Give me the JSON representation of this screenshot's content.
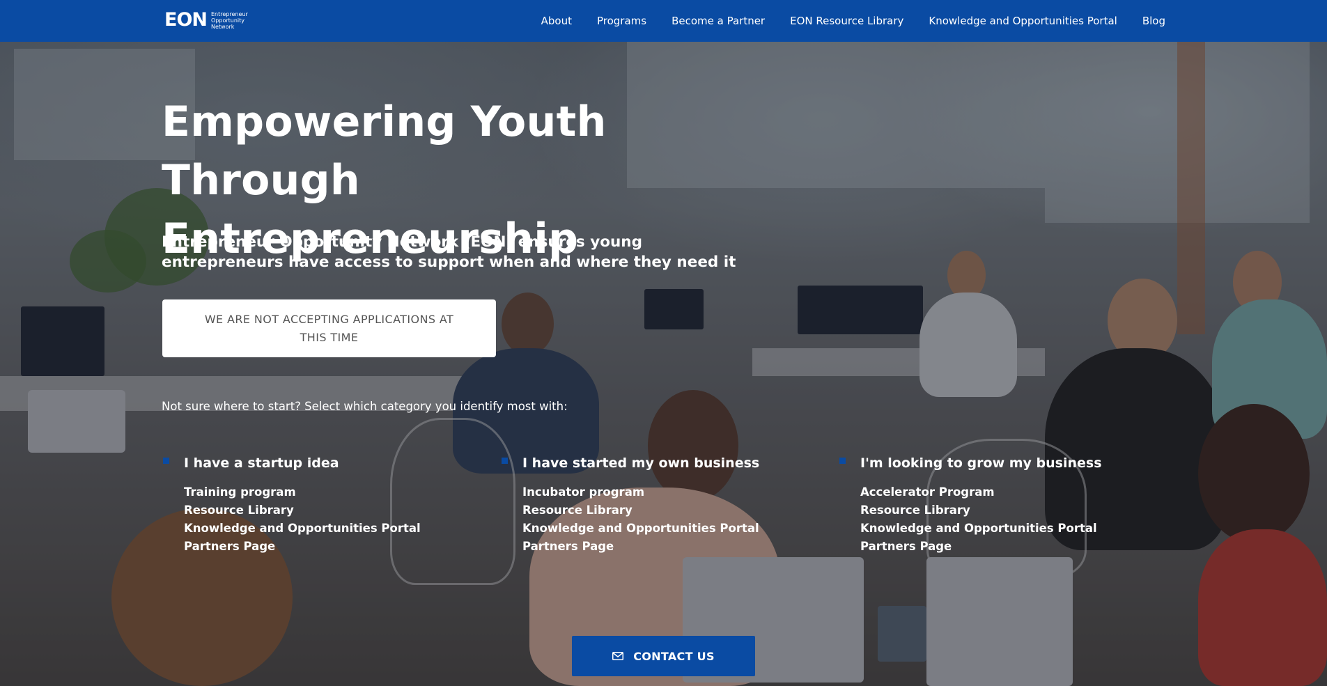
{
  "brand": {
    "logo_mark": "EON",
    "logo_lines": [
      "Entrepreneur",
      "Opportunity",
      "Network"
    ],
    "primary_color": "#0a4ba3"
  },
  "nav": {
    "items": [
      {
        "label": "About"
      },
      {
        "label": "Programs"
      },
      {
        "label": "Become a Partner"
      },
      {
        "label": "EON Resource Library"
      },
      {
        "label": "Knowledge and Opportunities Portal"
      },
      {
        "label": "Blog"
      }
    ]
  },
  "hero": {
    "title_line1": "Empowering Youth",
    "title_line2": "Through Entrepreneurship",
    "subtitle": "Entrepreneur Opportunity Network (EON) ensures young entrepreneurs have access to support when and where they need it",
    "status_button": "WE ARE NOT ACCEPTING APPLICATIONS AT THIS TIME",
    "prompt": "Not sure where to start? Select which category you identify most with:"
  },
  "categories": [
    {
      "title": "I have a startup idea",
      "links": [
        "Training program",
        "Resource Library",
        "Knowledge and Opportunities Portal",
        "Partners Page"
      ]
    },
    {
      "title": "I have started my own business",
      "links": [
        "Incubator program",
        "Resource Library",
        "Knowledge and Opportunities Portal",
        "Partners Page"
      ]
    },
    {
      "title": "I'm looking to grow my business",
      "links": [
        "Accelerator Program",
        "Resource Library",
        "Knowledge and Opportunities Portal",
        "Partners Page"
      ]
    }
  ],
  "contact": {
    "label": "CONTACT US",
    "icon": "envelope-icon"
  }
}
